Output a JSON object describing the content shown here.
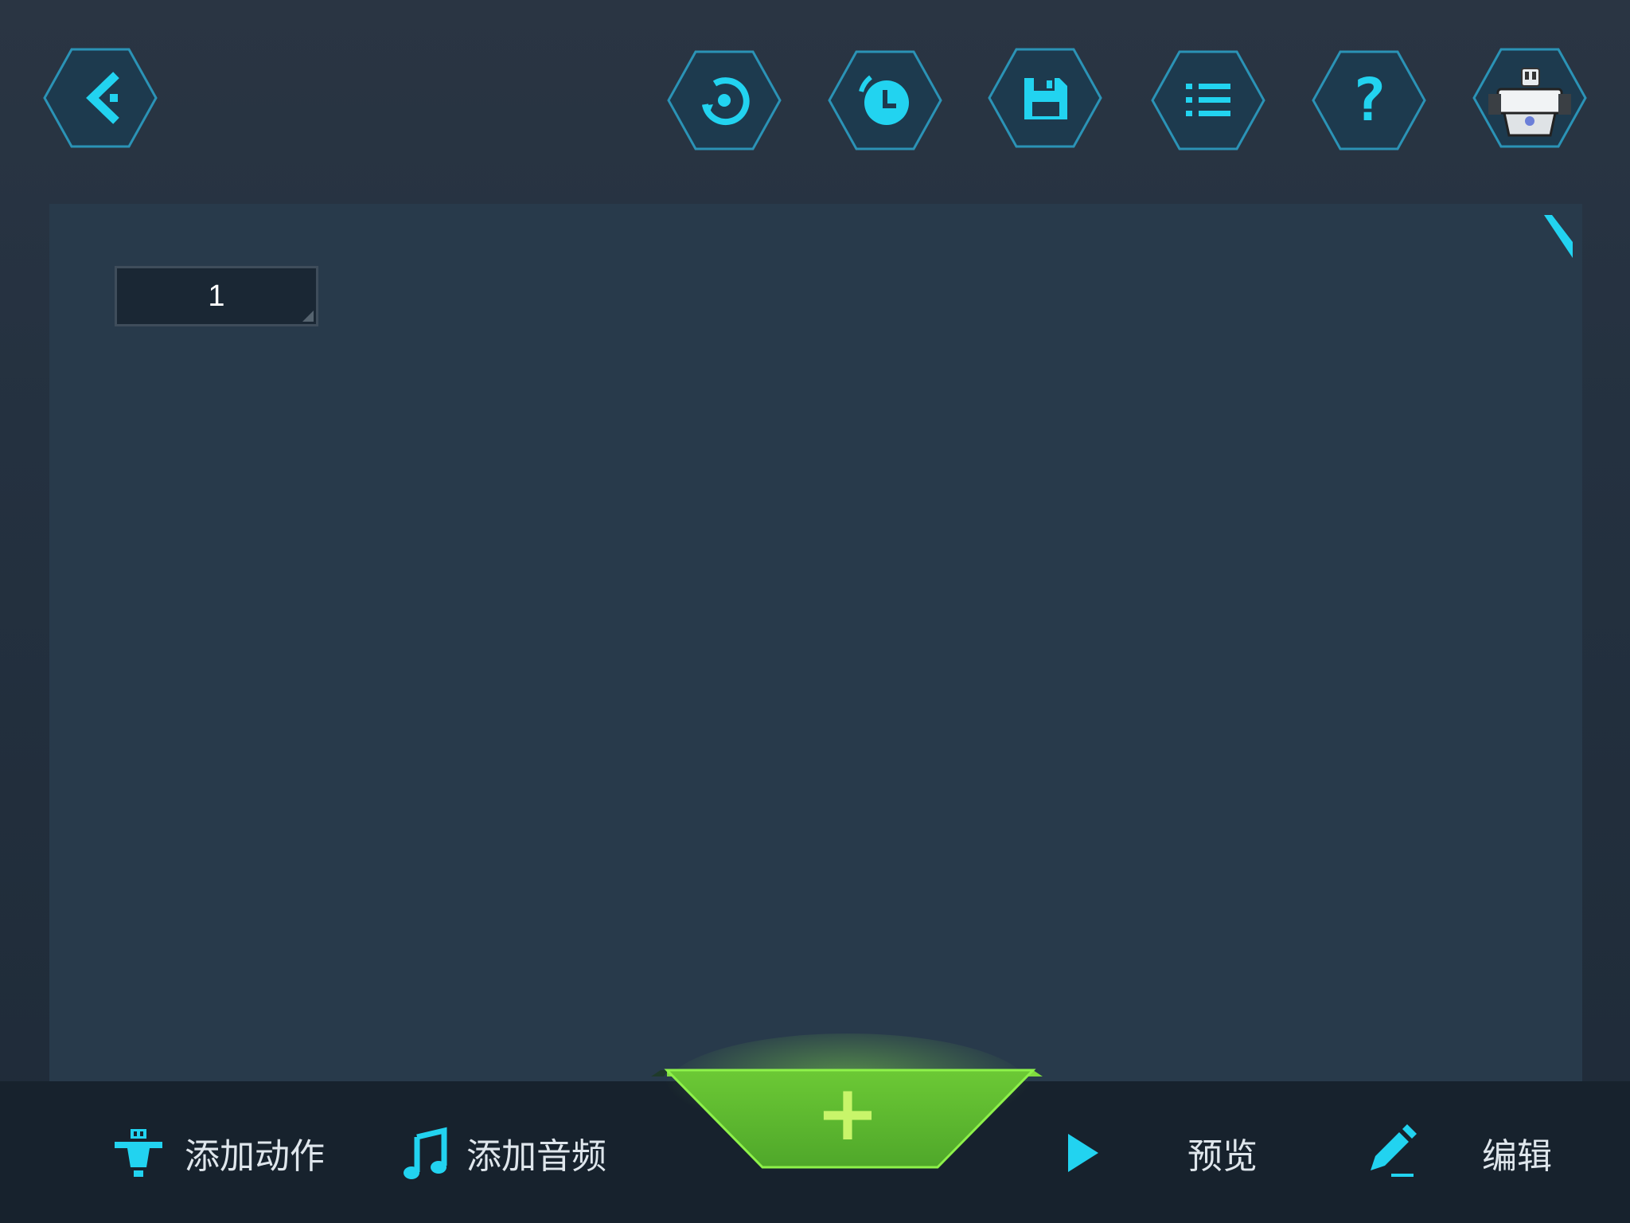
{
  "toolbar": {
    "back_icon": "chevron-left-icon",
    "buttons": [
      {
        "icon": "reset-icon"
      },
      {
        "icon": "timer-icon"
      },
      {
        "icon": "save-icon"
      },
      {
        "icon": "list-icon"
      },
      {
        "icon": "help-icon",
        "glyph": "?"
      },
      {
        "icon": "robot-avatar"
      }
    ]
  },
  "canvas": {
    "frame_number": "1"
  },
  "bottom_bar": {
    "add_action_label": "添加动作",
    "add_audio_label": "添加音频",
    "add_button_glyph": "+",
    "preview_label": "预览",
    "edit_label": "编辑"
  },
  "colors": {
    "accent_cyan": "#22d3f0",
    "hex_fill": "#1f3d52",
    "hex_stroke": "#2a8fb0",
    "panel": "#283a4b",
    "bottom_bar": "#17222d",
    "add_green": "#5ab52e"
  }
}
